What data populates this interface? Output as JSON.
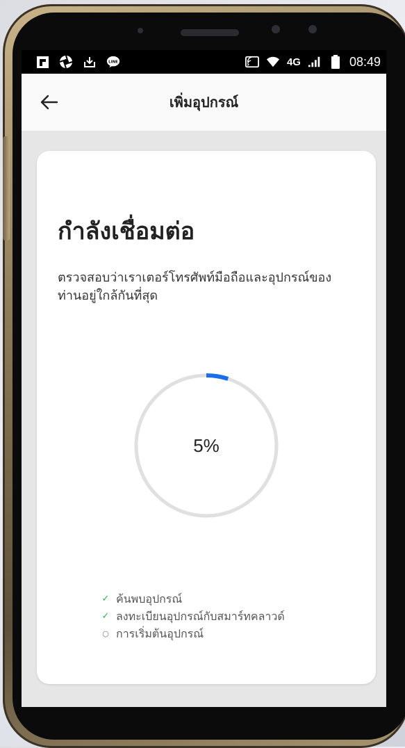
{
  "status_bar": {
    "notification_icons": [
      "flipboard-icon",
      "shutter-icon",
      "download-icon",
      "line-icon"
    ],
    "network": "4G",
    "time": "08:49"
  },
  "app_bar": {
    "title": "เพิ่มอุปกรณ์",
    "back_icon": "arrow-left-icon"
  },
  "connecting": {
    "heading": "กำลังเชื่อมต่อ",
    "description": "ตรวจสอบว่าเราเตอร์โทรศัพท์มือถือและอุปกรณ์ของท่านอยู่ใกล้กันที่สุด",
    "progress_percent": 5,
    "progress_label": "5%",
    "steps": [
      {
        "label": "ค้นพบอุปกรณ์",
        "status": "done"
      },
      {
        "label": "ลงทะเบียนอุปกรณ์กับสมาร์ทคลาวด์",
        "status": "done"
      },
      {
        "label": "การเริ่มต้นอุปกรณ์",
        "status": "pending"
      }
    ]
  },
  "colors": {
    "accent": "#1a6fe8",
    "track": "#e0e0e0",
    "done_check": "#2fae5a"
  }
}
